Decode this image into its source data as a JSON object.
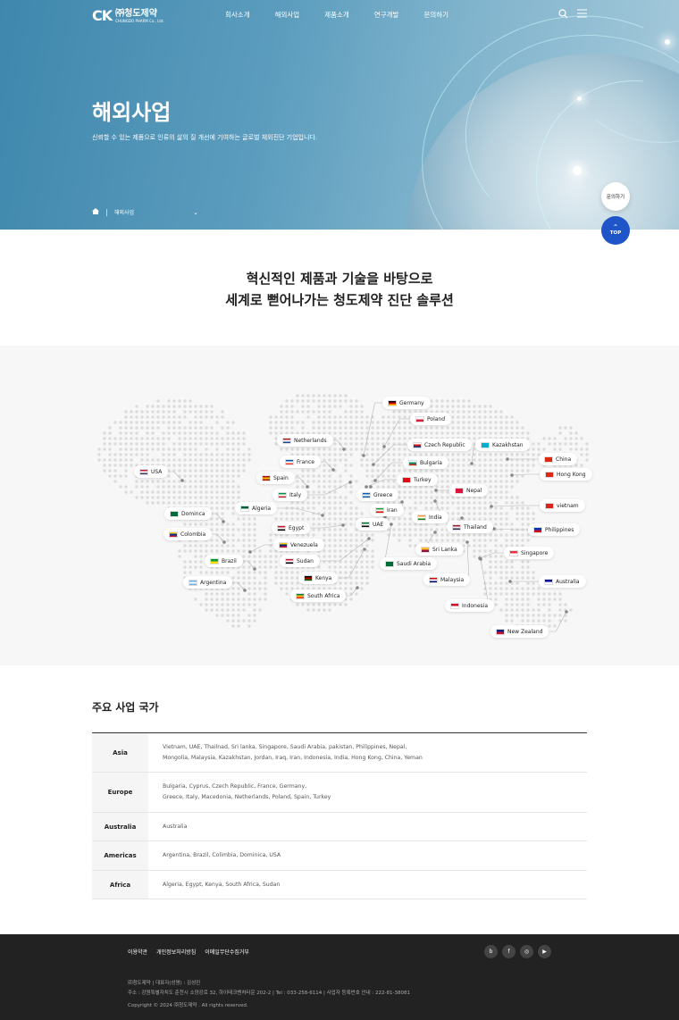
{
  "header": {
    "logo_mark": "CK",
    "logo_kr": "㈜청도제약",
    "logo_en": "CHUNGDO PHARM Co., Ltd.",
    "nav": [
      "회사소개",
      "해외사업",
      "제품소개",
      "연구개발",
      "문의하기"
    ]
  },
  "hero": {
    "title": "해외사업",
    "subtitle": "신뢰할 수 있는 제품으로 인류의 삶의 질 개선에 기여하는 글로벌 체외진단 기업입니다.",
    "breadcrumb": "해외사업"
  },
  "floating": {
    "inquiry": "문의하기",
    "top": "TOP"
  },
  "intro": {
    "line1": "혁신적인 제품과 기술을 바탕으로",
    "line2": "세계로 뻗어나가는 청도제약 진단 솔루션"
  },
  "map": {
    "countries": [
      {
        "name": "Germany",
        "colors": [
          "#000",
          "#d00",
          "#fc0"
        ]
      },
      {
        "name": "Poland",
        "colors": [
          "#fff",
          "#d4213d"
        ]
      },
      {
        "name": "Netherlands",
        "colors": [
          "#ae1c28",
          "#fff",
          "#21468b"
        ]
      },
      {
        "name": "Czech Republic",
        "colors": [
          "#fff",
          "#d7141a",
          "#11457e"
        ]
      },
      {
        "name": "Kazakhstan",
        "colors": [
          "#00afca"
        ]
      },
      {
        "name": "France",
        "colors": [
          "#0055a4",
          "#fff",
          "#ef4135"
        ]
      },
      {
        "name": "Bulgaria",
        "colors": [
          "#fff",
          "#00966e",
          "#d62612"
        ]
      },
      {
        "name": "China",
        "colors": [
          "#de2910"
        ]
      },
      {
        "name": "USA",
        "colors": [
          "#b22234",
          "#fff",
          "#3c3b6e"
        ]
      },
      {
        "name": "Spain",
        "colors": [
          "#aa151b",
          "#f1bf00",
          "#aa151b"
        ]
      },
      {
        "name": "Turkey",
        "colors": [
          "#e30a17"
        ]
      },
      {
        "name": "Hong Kong",
        "colors": [
          "#de2910"
        ]
      },
      {
        "name": "Italy",
        "colors": [
          "#009246",
          "#fff",
          "#ce2b37"
        ]
      },
      {
        "name": "Greece",
        "colors": [
          "#0d5eaf",
          "#fff",
          "#0d5eaf"
        ]
      },
      {
        "name": "Nepal",
        "colors": [
          "#dc143c"
        ]
      },
      {
        "name": "Algeria",
        "colors": [
          "#006233",
          "#fff"
        ]
      },
      {
        "name": "Iran",
        "colors": [
          "#239f40",
          "#fff",
          "#da0000"
        ]
      },
      {
        "name": "vietnam",
        "colors": [
          "#da251d"
        ]
      },
      {
        "name": "Dominca",
        "colors": [
          "#006b3f"
        ]
      },
      {
        "name": "India",
        "colors": [
          "#ff9933",
          "#fff",
          "#138808"
        ]
      },
      {
        "name": "Egypt",
        "colors": [
          "#ce1126",
          "#fff",
          "#000"
        ]
      },
      {
        "name": "UAE",
        "colors": [
          "#00732f",
          "#fff",
          "#000"
        ]
      },
      {
        "name": "Thailand",
        "colors": [
          "#a51931",
          "#f4f5f8",
          "#2d2a4a"
        ]
      },
      {
        "name": "Philippines",
        "colors": [
          "#0038a8",
          "#ce1126"
        ]
      },
      {
        "name": "Colombia",
        "colors": [
          "#fcd116",
          "#003893",
          "#ce1126"
        ]
      },
      {
        "name": "Venezuela",
        "colors": [
          "#ffcc00",
          "#00247d",
          "#cf142b"
        ]
      },
      {
        "name": "Sri Lanka",
        "colors": [
          "#ffbe29",
          "#8d153a"
        ]
      },
      {
        "name": "Singapore",
        "colors": [
          "#ef3340",
          "#fff"
        ]
      },
      {
        "name": "Brazil",
        "colors": [
          "#009c3b",
          "#ffdf00"
        ]
      },
      {
        "name": "Sudan",
        "colors": [
          "#d21034",
          "#fff",
          "#000"
        ]
      },
      {
        "name": "Saudi Arabia",
        "colors": [
          "#006c35"
        ]
      },
      {
        "name": "Kenya",
        "colors": [
          "#000",
          "#bb0000",
          "#006600"
        ]
      },
      {
        "name": "Malaysia",
        "colors": [
          "#cc0001",
          "#fff",
          "#010066"
        ]
      },
      {
        "name": "Australia",
        "colors": [
          "#00008b",
          "#fff"
        ]
      },
      {
        "name": "Argentina",
        "colors": [
          "#74acdf",
          "#fff",
          "#74acdf"
        ]
      },
      {
        "name": "South Africa",
        "colors": [
          "#007a4d",
          "#ffb612",
          "#de3831"
        ]
      },
      {
        "name": "Indonesia",
        "colors": [
          "#ce1126",
          "#fff"
        ]
      },
      {
        "name": "New Zealand",
        "colors": [
          "#00247d",
          "#cc142b"
        ]
      }
    ]
  },
  "business": {
    "title": "주요 사업 국가",
    "rows": [
      {
        "region": "Asia",
        "lines": [
          "Vietnam, UAE, Thailnad, Sri lanka, Singapore, Saudi Arabia, pakistan, Philippines, Nepal,",
          "Mongolia, Malaysia, Kazakhstan, Jordan, Iraq, Iran, Indonesia, India, Hong Kong, China, Yeman"
        ]
      },
      {
        "region": "Europe",
        "lines": [
          "Bulgaria, Cyprus, Czech Republic, France, Germany,",
          "Greece, Italy, Macedonia, Netherlands, Poland, Spain, Turkey"
        ]
      },
      {
        "region": "Australia",
        "lines": [
          "Australia"
        ]
      },
      {
        "region": "Americas",
        "lines": [
          "Argentina, Brazil, Colimbia, Dominica, USA"
        ]
      },
      {
        "region": "Africa",
        "lines": [
          "Algeria, Egypt, Kenya, South Africa, Sudan"
        ]
      }
    ]
  },
  "footer": {
    "links": [
      "이용약관",
      "개인정보처리방침",
      "이메일무단수집거부"
    ],
    "social": [
      "b",
      "f",
      "◎",
      "▶"
    ],
    "line1": "㈜청도제약   |   대표자(성명) : 김성진",
    "line2": "주소 : 강원특별자치도 춘천시 소양강로 32, 하이테크벤처타운 202-2   |   Tel : 033-258-6114   |   사업자 등록번호 안내 : 222-81-38081",
    "copyright": "Copyright © 2024 ㈜청도제약 . All rights reserved."
  }
}
